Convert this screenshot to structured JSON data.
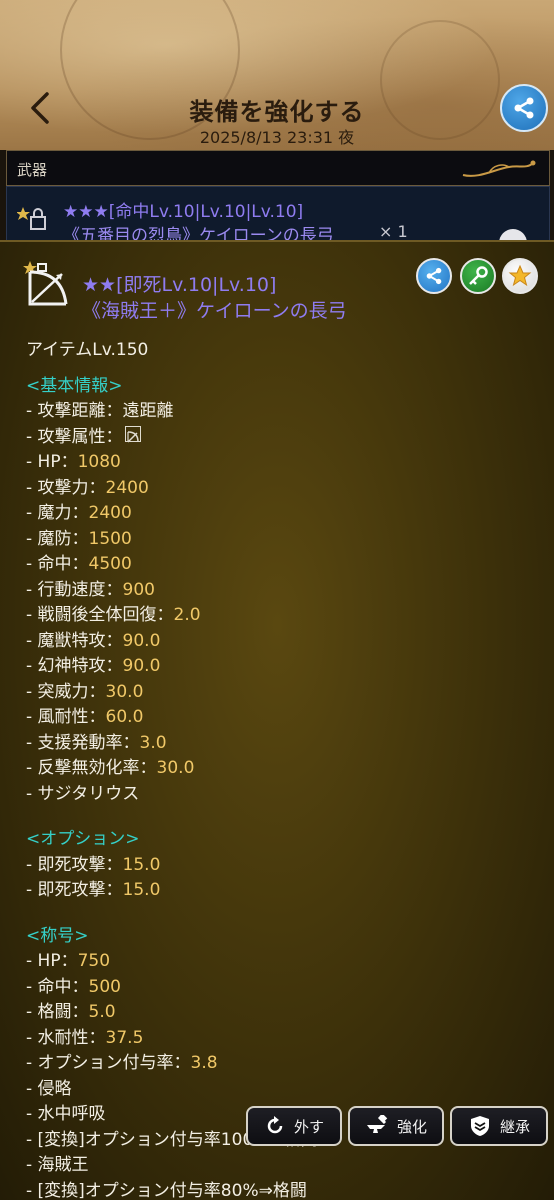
{
  "header": {
    "title": "装備を強化する",
    "datetime": "2025/8/13  23:31  夜"
  },
  "category": {
    "label": "武器"
  },
  "equip_item": {
    "stars": "★★★[命中Lv.10|Lv.10|Lv.10]",
    "name": "《五番目の烈鳥》ケイローンの長弓",
    "count": "× 1"
  },
  "panel": {
    "stars_line": "★★[即死Lv.10|Lv.10]",
    "name": "《海賊王＋》ケイローンの長弓",
    "item_level": "アイテムLv.150",
    "basic_header": "<基本情報>",
    "basic": [
      {
        "label": "攻撃距離：",
        "value": "遠距離",
        "plain": true
      },
      {
        "label": "攻撃属性：",
        "value": "",
        "icon": "bow-attribute-icon"
      },
      {
        "label": "HP：",
        "value": "1080"
      },
      {
        "label": "攻撃力：",
        "value": "2400"
      },
      {
        "label": "魔力：",
        "value": "2400"
      },
      {
        "label": "魔防：",
        "value": "1500"
      },
      {
        "label": "命中：",
        "value": "4500"
      },
      {
        "label": "行動速度：",
        "value": "900"
      },
      {
        "label": "戦闘後全体回復：",
        "value": "2.0"
      },
      {
        "label": "魔獣特攻：",
        "value": "90.0"
      },
      {
        "label": "幻神特攻：",
        "value": "90.0"
      },
      {
        "label": "突威力：",
        "value": "30.0"
      },
      {
        "label": "風耐性：",
        "value": "60.0"
      },
      {
        "label": "支援発動率：",
        "value": "3.0"
      },
      {
        "label": "反撃無効化率：",
        "value": "30.0"
      },
      {
        "label": "サジタリウス",
        "value": ""
      }
    ],
    "option_header": "<オプション>",
    "options": [
      {
        "label": "即死攻撃：",
        "value": "15.0"
      },
      {
        "label": "即死攻撃：",
        "value": "15.0"
      }
    ],
    "title_header": "<称号>",
    "titles": [
      {
        "label": "HP：",
        "value": "750"
      },
      {
        "label": "命中：",
        "value": "500"
      },
      {
        "label": "格闘：",
        "value": "5.0"
      },
      {
        "label": "水耐性：",
        "value": "37.5"
      },
      {
        "label": "オプション付与率：",
        "value": "3.8"
      },
      {
        "label": "侵略",
        "value": ""
      },
      {
        "label": "水中呼吸",
        "value": ""
      },
      {
        "label": "[変換]オプション付与率100%⇒格闘",
        "value": ""
      },
      {
        "label": "海賊王",
        "value": ""
      },
      {
        "label": "[変換]オプション付与率80%⇒格闘",
        "value": ""
      }
    ]
  },
  "actions": {
    "unequip": "外す",
    "enhance": "強化",
    "inherit": "継承"
  },
  "colors": {
    "section": "#35d0c8",
    "value": "#f0c868",
    "stars": "#8f7cf0"
  }
}
